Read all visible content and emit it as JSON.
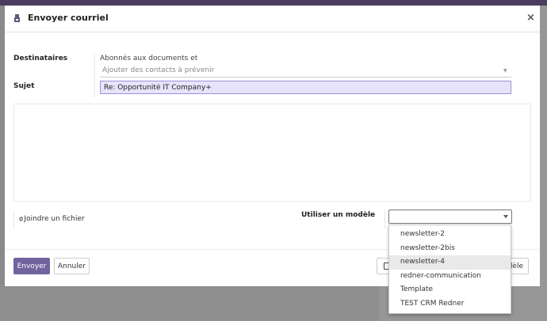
{
  "modal": {
    "title": "Envoyer courriel",
    "close_label": "×"
  },
  "form": {
    "recipients_label": "Destinataires",
    "followers_text": "Abonnés aux documents et",
    "contacts_placeholder": "Ajouter des contacts à prévenir",
    "subject_label": "Sujet",
    "subject_value": "Re: Opportunité IT Company+",
    "attach_label": "Joindre un fichier",
    "template_label": "Utiliser un modèle",
    "template_value": ""
  },
  "footer": {
    "send_label": "Envoyer",
    "cancel_label": "Annuler",
    "save_template_label": "dèle"
  },
  "template_options": [
    {
      "label": "newsletter-2",
      "highlighted": false
    },
    {
      "label": "newsletter-2bis",
      "highlighted": false
    },
    {
      "label": "newsletter-4",
      "highlighted": true
    },
    {
      "label": "redner-communication",
      "highlighted": false
    },
    {
      "label": "Template",
      "highlighted": false
    },
    {
      "label": "TEST CRM Redner",
      "highlighted": false
    }
  ],
  "colors": {
    "primary": "#71639e",
    "subject_bg": "#e7e3fb",
    "highlight": "#e9e9e9"
  },
  "icons": {
    "modal": "envelope-icon",
    "attach": "paperclip-icon",
    "save": "floppy-icon"
  }
}
